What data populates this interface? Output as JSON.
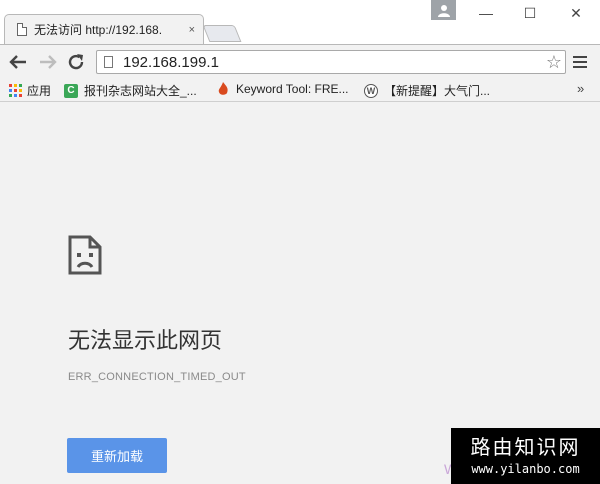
{
  "tab": {
    "title": "无法访问 http://192.168.",
    "close": "×"
  },
  "window": {
    "minimize": "—",
    "maximize": "☐",
    "close": "✕"
  },
  "toolbar": {
    "url": "192.168.199.1",
    "star": "☆"
  },
  "bookmarks": {
    "apps_label": "应用",
    "items": [
      {
        "label": "报刊杂志网站大全_...",
        "icon": "C",
        "color": "#3aa757"
      },
      {
        "label": "Keyword Tool: FRE...",
        "icon": "",
        "color": "#d94a1e"
      },
      {
        "label": "【新提醒】大气门...",
        "icon": "W",
        "color": "#555555"
      }
    ],
    "more": "»"
  },
  "error": {
    "title": "无法显示此网页",
    "code": "ERR_CONNECTION_TIMED_OUT",
    "reload_label": "重新加载"
  },
  "watermark": {
    "title": "路由知识网",
    "url": "www.yilanbo.com",
    "letter": "W"
  },
  "colors": {
    "reload_button": "#5a94e8",
    "page_background": "#f2f2f2"
  }
}
